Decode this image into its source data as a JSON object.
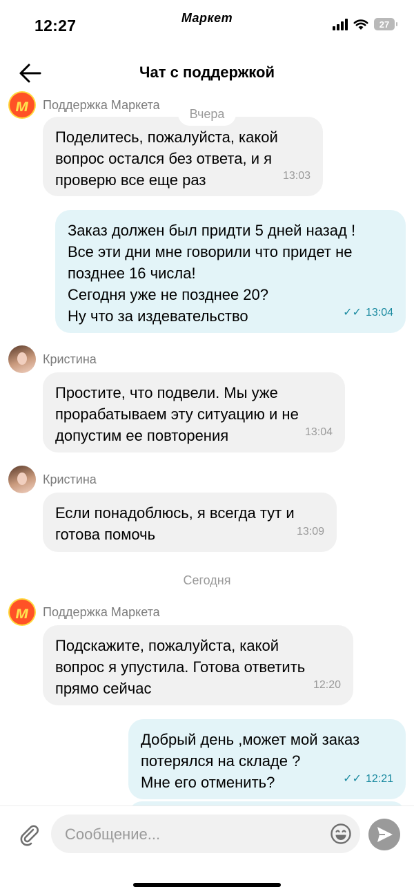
{
  "status_bar": {
    "time": "12:27",
    "carrier": "Маркет",
    "battery": "27"
  },
  "header": {
    "title": "Чат с поддержкой"
  },
  "dates": {
    "yesterday": "Вчера",
    "today": "Сегодня"
  },
  "messages": [
    {
      "sender": "Поддержка Маркета",
      "text": "Поделитесь, пожалуйста, какой вопрос остался без ответа, и я проверю все еще раз",
      "time": "13:03"
    },
    {
      "text": "Заказ должен был придти 5 дней назад ! Все эти дни мне говорили что придет не позднее 16 числа! Сегодня уже не позднее 20? Ну что за издевательство",
      "time": "13:04"
    },
    {
      "sender": "Кристина",
      "text": "Простите, что подвели. Мы уже прорабатываем эту ситуацию и не допустим ее повторения",
      "time": "13:04"
    },
    {
      "sender": "Кристина",
      "text": "Если понадоблюсь, я всегда тут и готова помочь",
      "time": "13:09"
    },
    {
      "sender": "Поддержка Маркета",
      "text": "Подскажите, пожалуйста, какой вопрос я упустила. Готова ответить прямо сейчас",
      "time": "12:20"
    },
    {
      "text": "Добрый день ,может мой заказ потерялся на складе ? Мне его отменить?",
      "time": "12:21"
    }
  ],
  "lines": {
    "m0": [
      "Поделитесь, пожалуйста, какой",
      "вопрос остался без ответа, и я",
      "проверю все еще раз"
    ],
    "m1": [
      "Заказ должен был придти 5 дней назад !",
      "Все эти дни мне говорили что придет не",
      "позднее 16 числа!",
      "Сегодня уже не позднее 20?",
      "Ну что за издевательство"
    ],
    "m2": [
      "Простите, что подвели. Мы уже",
      "прорабатываем эту ситуацию и не",
      "допустим ее повторения"
    ],
    "m3": [
      "Если понадоблюсь, я всегда тут и",
      "готова помочь"
    ],
    "m4": [
      "Подскажите, пожалуйста, какой",
      "вопрос я упустила. Готова ответить",
      "прямо сейчас"
    ],
    "m5": [
      "Добрый день ,может мой заказ",
      "потерялся на складе ?",
      "Мне его отменить?"
    ]
  },
  "input": {
    "placeholder": "Сообщение..."
  },
  "colors": {
    "incoming_bubble": "#f1f1f1",
    "outgoing_bubble": "#e3f4f8",
    "read_check": "#1a8aa0"
  },
  "icons": [
    "back-arrow-icon",
    "paperclip-icon",
    "emoji-icon",
    "send-icon",
    "double-check-icon"
  ]
}
